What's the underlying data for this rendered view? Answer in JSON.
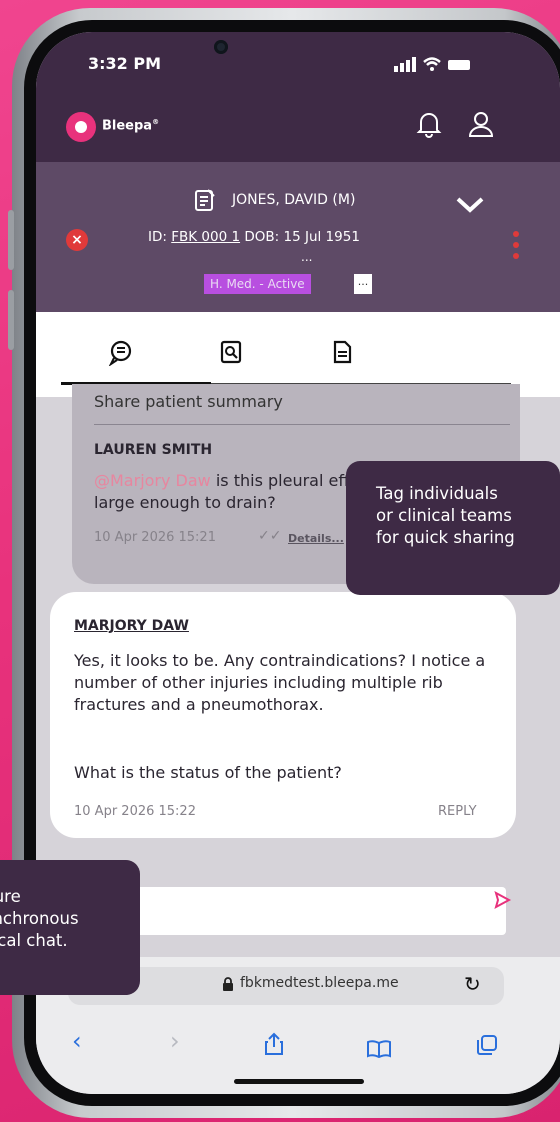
{
  "status_bar": {
    "time": "3:32 PM",
    "signal_icons": "▂▄▆ ≋ ▬"
  },
  "app": {
    "brand": "Bleepa",
    "brand_mark": "®"
  },
  "patient": {
    "name": "JONES, DAVID (M)",
    "id_label": "ID:",
    "id_value": "FBK 000 1",
    "dob_label": "DOB:",
    "dob_value": "15 Jul 1951",
    "ellipsis": "...",
    "status_badge": "H. Med. - Active",
    "more": "..."
  },
  "tabs": [
    {
      "name": "chat-tab",
      "icon": "chat-bubble-icon"
    },
    {
      "name": "search-tab",
      "icon": "search-document-icon"
    },
    {
      "name": "notes-tab",
      "icon": "document-icon"
    }
  ],
  "messages": [
    {
      "header": "Share patient summary",
      "sender": "LAUREN SMITH",
      "mention": "@Marjory Daw",
      "text_after_mention": " is this pleural effusion",
      "text_line2": "large enough to drain?",
      "timestamp": "10 Apr 2026 15:21",
      "details": "Details..."
    },
    {
      "sender": "MARJORY DAW",
      "paragraph1": "Yes, it looks to be. Any contraindications? I notice a number of other injuries including multiple rib fractures and a pneumothorax.",
      "paragraph2": "What is the status of the patient?",
      "timestamp": "10 Apr 2026 15:22",
      "reply": "REPLY"
    }
  ],
  "composer": {
    "send_icon": "send-icon"
  },
  "browser": {
    "url": "fbkmedtest.bleepa.me",
    "nav": [
      "back-icon",
      "forward-icon",
      "share-icon",
      "bookmarks-icon",
      "tabs-icon"
    ]
  },
  "callouts": {
    "tag": [
      "Tag individuals",
      "or clinical teams",
      "for quick sharing"
    ],
    "chat": [
      "Secure",
      "asynchronous",
      "clinical chat."
    ]
  },
  "colors": {
    "accent": "#e8327c",
    "header": "#3e2a45",
    "badge": "#b84fe0",
    "mention": "#e7869f"
  }
}
